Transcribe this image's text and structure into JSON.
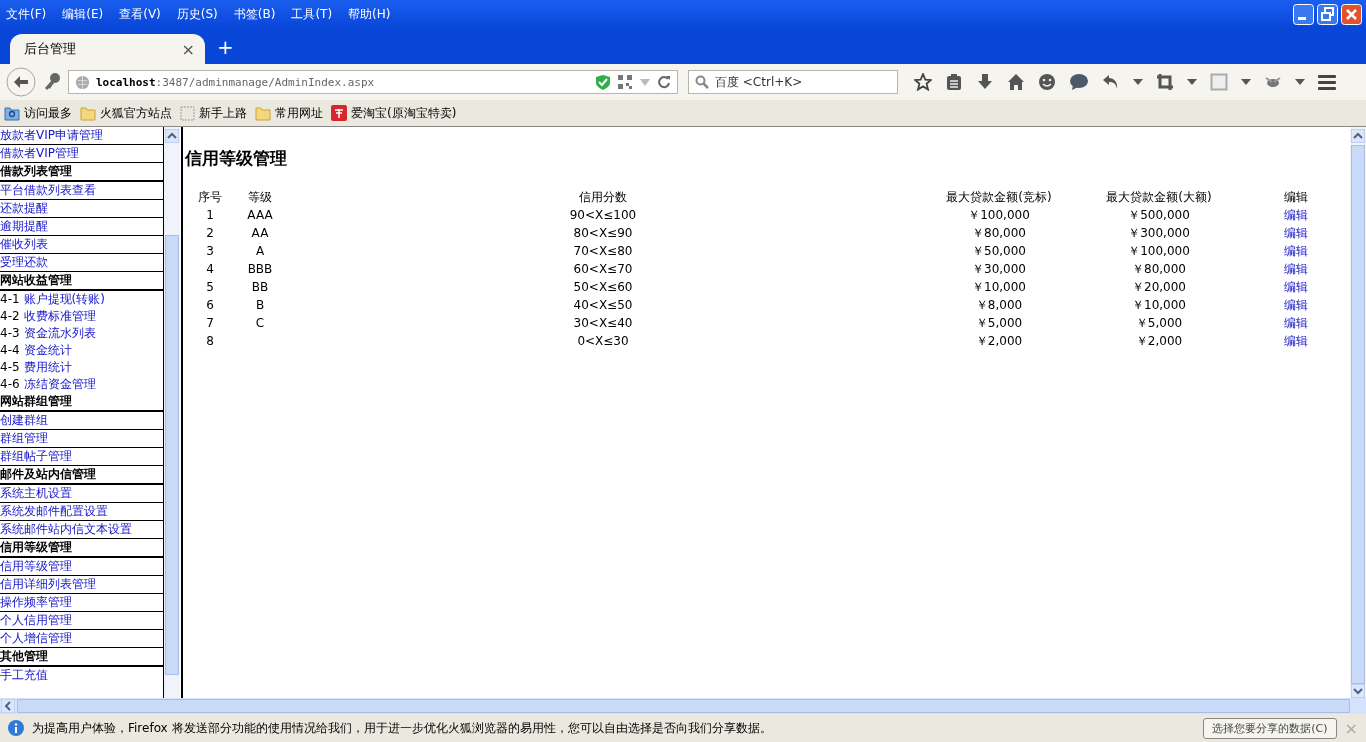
{
  "menu_bar": [
    "文件(F)",
    "编辑(E)",
    "查看(V)",
    "历史(S)",
    "书签(B)",
    "工具(T)",
    "帮助(H)"
  ],
  "tabs": [
    {
      "label": "后台管理",
      "selected": true,
      "close": "×"
    }
  ],
  "new_tab": "+",
  "address_bar": {
    "host": "localhost",
    "path": ":3487/adminmanage/AdminIndex.aspx"
  },
  "search": {
    "placeholder": "百度 <Ctrl+K>"
  },
  "bookmarks": [
    {
      "label": "访问最多",
      "kind": "smart"
    },
    {
      "label": "火狐官方站点",
      "kind": "folder"
    },
    {
      "label": "新手上路",
      "kind": "blank"
    },
    {
      "label": "常用网址",
      "kind": "folder"
    },
    {
      "label": "爱淘宝(原淘宝特卖)",
      "kind": "taobao"
    }
  ],
  "sidebar": [
    {
      "kind": "link",
      "label": "放款者VIP申请管理"
    },
    {
      "kind": "link",
      "label": "借款者VIP管理"
    },
    {
      "kind": "header",
      "label": "借款列表管理"
    },
    {
      "kind": "link",
      "label": "平台借款列表查看"
    },
    {
      "kind": "link",
      "label": "还款提醒"
    },
    {
      "kind": "link",
      "label": "逾期提醒"
    },
    {
      "kind": "link",
      "label": "催收列表"
    },
    {
      "kind": "link",
      "label": "受理还款"
    },
    {
      "kind": "header",
      "label": "网站收益管理"
    },
    {
      "kind": "numbered",
      "number": "4-1",
      "label": "账户提现(转账)"
    },
    {
      "kind": "numbered",
      "number": "4-2",
      "label": "收费标准管理"
    },
    {
      "kind": "numbered",
      "number": "4-3",
      "label": "资金流水列表"
    },
    {
      "kind": "numbered",
      "number": "4-4",
      "label": "资金统计"
    },
    {
      "kind": "numbered",
      "number": "4-5",
      "label": "费用统计"
    },
    {
      "kind": "numbered",
      "number": "4-6",
      "label": "冻结资金管理"
    },
    {
      "kind": "header",
      "label": "网站群组管理"
    },
    {
      "kind": "link",
      "label": "创建群组"
    },
    {
      "kind": "link",
      "label": "群组管理"
    },
    {
      "kind": "link",
      "label": "群组帖子管理"
    },
    {
      "kind": "header",
      "label": "邮件及站内信管理"
    },
    {
      "kind": "link",
      "label": "系统主机设置"
    },
    {
      "kind": "link",
      "label": "系统发邮件配置设置"
    },
    {
      "kind": "link",
      "label": "系统邮件站内信文本设置"
    },
    {
      "kind": "header",
      "label": "信用等级管理"
    },
    {
      "kind": "link",
      "label": "信用等级管理"
    },
    {
      "kind": "link",
      "label": "信用详细列表管理"
    },
    {
      "kind": "link",
      "label": "操作频率管理"
    },
    {
      "kind": "link",
      "label": "个人信用管理"
    },
    {
      "kind": "link",
      "label": "个人增信管理"
    },
    {
      "kind": "header",
      "label": "其他管理"
    },
    {
      "kind": "link",
      "label": "手工充值"
    }
  ],
  "page_title": "信用等级管理",
  "table": {
    "columns": [
      "序号",
      "等级",
      "信用分数",
      "最大贷款金额(竞标)",
      "最大贷款金额(大额)",
      "编辑"
    ],
    "rows": [
      [
        "1",
        "AAA",
        "90<X≤100",
        "￥100,000",
        "￥500,000",
        "编辑"
      ],
      [
        "2",
        "AA",
        "80<X≤90",
        "￥80,000",
        "￥300,000",
        "编辑"
      ],
      [
        "3",
        "A",
        "70<X≤80",
        "￥50,000",
        "￥100,000",
        "编辑"
      ],
      [
        "4",
        "BBB",
        "60<X≤70",
        "￥30,000",
        "￥80,000",
        "编辑"
      ],
      [
        "5",
        "BB",
        "50<X≤60",
        "￥10,000",
        "￥20,000",
        "编辑"
      ],
      [
        "6",
        "B",
        "40<X≤50",
        "￥8,000",
        "￥10,000",
        "编辑"
      ],
      [
        "7",
        "C",
        "30<X≤40",
        "￥5,000",
        "￥5,000",
        "编辑"
      ],
      [
        "8",
        "",
        "0<X≤30",
        "￥2,000",
        "￥2,000",
        "编辑"
      ]
    ]
  },
  "notification": {
    "text": "为提高用户体验，Firefox 将发送部分功能的使用情况给我们，用于进一步优化火狐浏览器的易用性，您可以自由选择是否向我们分享数据。",
    "button": "选择您要分享的数据(C)",
    "close": "×"
  }
}
